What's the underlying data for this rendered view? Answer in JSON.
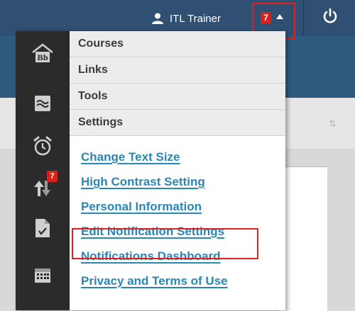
{
  "header": {
    "user_name": "ITL Trainer",
    "notification_count": "7"
  },
  "rail": {
    "items": [
      {
        "name": "blackboard-home-icon"
      },
      {
        "name": "stream-icon"
      },
      {
        "name": "alarm-clock-icon"
      },
      {
        "name": "updates-icon",
        "badge": "7"
      },
      {
        "name": "grades-icon"
      },
      {
        "name": "calendar-icon"
      }
    ]
  },
  "menu": {
    "categories": [
      "Courses",
      "Links",
      "Tools",
      "Settings"
    ],
    "settings_links": [
      "Change Text Size",
      "High Contrast Setting",
      "Personal Information",
      "Edit Notification Settings",
      "Notifications Dashboard",
      "Privacy and Terms of Use"
    ]
  },
  "colors": {
    "top_bar": "#2f4f73",
    "link": "#2a86b4",
    "badge": "#d8201c",
    "highlight_border": "#e12020"
  }
}
